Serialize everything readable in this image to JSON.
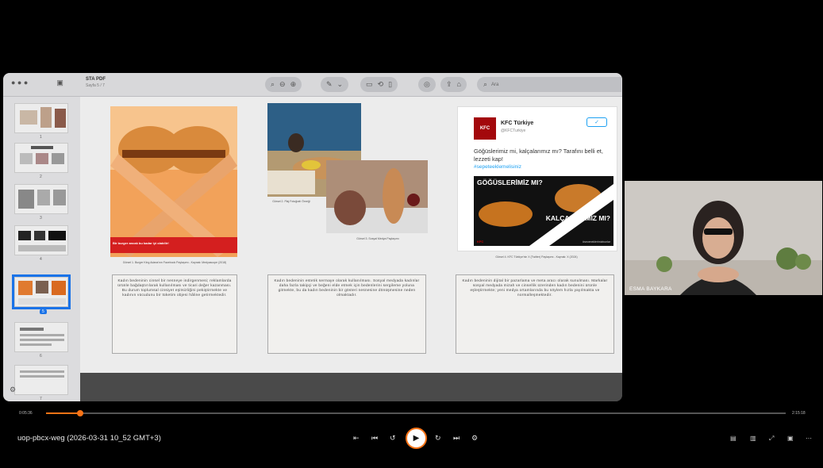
{
  "pdf_viewer": {
    "doc_title": "STA PDF",
    "doc_subtitle": "Sayfa 5 / 7",
    "search_placeholder": "Ara",
    "page_numbers": [
      "1",
      "2",
      "3",
      "4",
      "5",
      "6",
      "7"
    ]
  },
  "slide": {
    "captions": {
      "burger": "Görsel 1. Burger King Adana'nın Facebook Paylaşımı - Kaynak: Medyascope (2018)",
      "photo1": "Görsel 2. Plaj Fotoğrafı Örneği",
      "photo2": "Görsel 3. Sosyal Medya Paylaşımı",
      "kfc": "Görsel 4. KFC Türkiye'nin X (Twitter) Paylaşımı - Kaynak: X (2024)"
    },
    "textboxes": [
      "Kadın bedeninin cinsel bir nesneye indirgenmesi; reklamlarda ürünle bağdaştırılarak kullanılması ve ticari değer kazanması. Bu durum toplumsal cinsiyet eşitsizliğini pekiştirmekte ve kadının vücudunu bir tüketim objesi hâline getirmektedir.",
      "Kadın bedeninin estetik sermaye olarak kullanılması. Sosyal medyada kadınlar daha fazla takipçi ve beğeni elde etmek için bedenlerini sergileme yoluna gitmekte, bu da kadın bedeninin bir gösteri nesnesine dönüşmesine neden olmaktadır.",
      "Kadın bedeninin dijital bir pazarlama ve meta aracı olarak sunulması. Markalar sosyal medyada mizah ve cinsellik üzerinden kadın bedenini ürünle eşleştirmekte; yeni medya ortamlarında bu söylem hızla yayılmakta ve normalleşmektedir."
    ],
    "tweet": {
      "account_name": "KFC Türkiye",
      "handle": "@KFCTurkiye",
      "follow_label": "✓",
      "text": "Göğüslerimiz mi, kalçalarımız mı? Tarafını belli et, lezzeti kap!",
      "hashtag": "#sepeteeklemelisiniz",
      "banner_top": "GÖĞÜSLERİMİZ MI?",
      "banner_bottom": "KALÇALARIMIZ MI?",
      "banner_tag": "#seceneklerimizbunlar",
      "banner_logo": "KFC"
    },
    "burger_banner_text": "Bir burger ancak bu kadar iyi olabilir!"
  },
  "webcam": {
    "participant_name": "ESMA BAYKARA"
  },
  "player": {
    "time_current": "0:05:36",
    "time_total": "2:15:18",
    "progress": 0.046,
    "meeting_name": "uop-pbcx-weg (2026-03-31 10_52 GMT+3)",
    "controls": [
      "skip-start",
      "previous",
      "rewind",
      "play",
      "forward",
      "next",
      "settings"
    ],
    "right_controls": [
      "subtitles",
      "chapters",
      "fullscreen-toggle",
      "pip",
      "more"
    ]
  },
  "colors": {
    "accent": "#f97316",
    "selection": "#1a73e8",
    "kfc_red": "#a3080c",
    "twitter_blue": "#1da1f2"
  }
}
